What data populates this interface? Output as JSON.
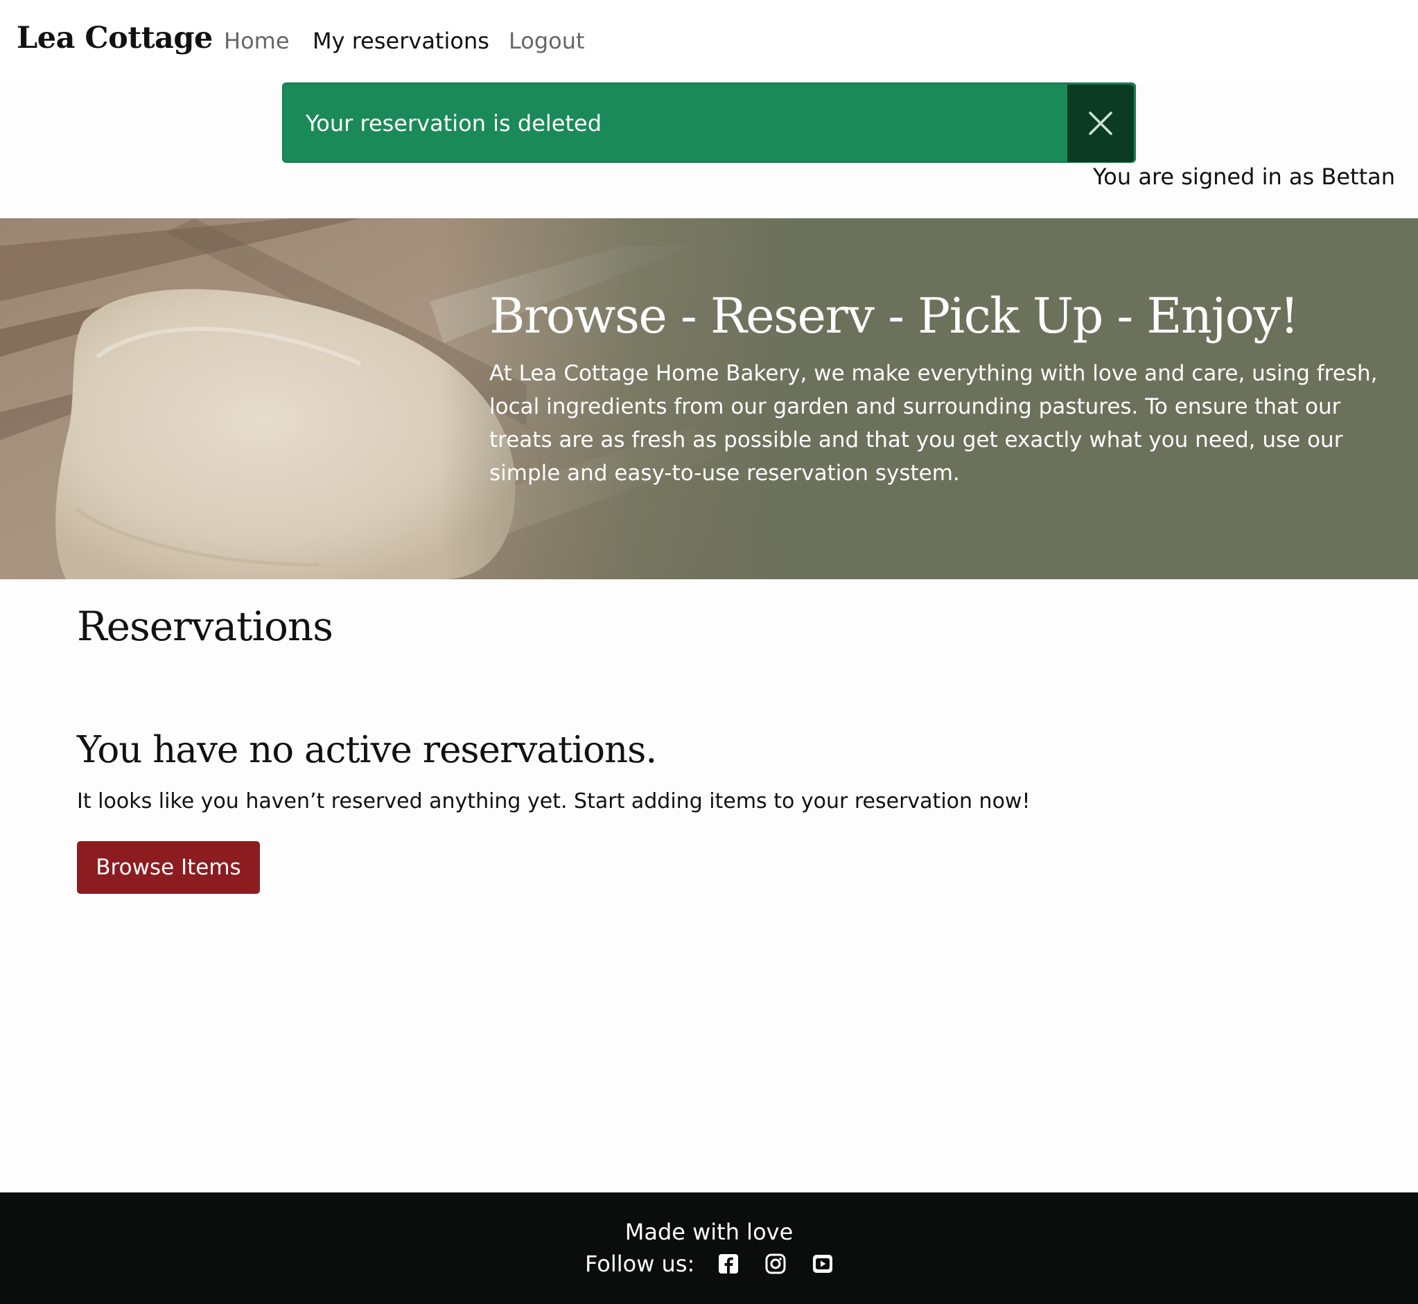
{
  "nav": {
    "brand": "Lea Cottage",
    "links": [
      "Home",
      "My reservations",
      "Logout"
    ]
  },
  "alert": {
    "message": "Your reservation is deleted",
    "close_icon": "close-icon"
  },
  "user": {
    "signed_in_text": "You are signed in as Bettan"
  },
  "hero": {
    "title": "Browse - Reserv - Pick Up - Enjoy!",
    "text": "At Lea Cottage Home Bakery, we make everything with love and care, using fresh, local ingredients from our garden and surrounding pastures. To ensure that our treats are as fresh as possible and that you get exactly what you need, use our simple and easy-to-use reservation system.",
    "image": "bread-dough-image"
  },
  "main": {
    "heading": "Reservations",
    "empty_title": "You have no active reservations.",
    "empty_text": "It looks like you haven’t reserved anything yet. Start adding items to your reservation now!",
    "browse_button": "Browse Items"
  },
  "footer": {
    "made_with": "Made with love",
    "follow": "Follow us:",
    "social_icons": [
      "facebook-icon",
      "instagram-icon",
      "youtube-icon"
    ]
  },
  "colors": {
    "alert_green": "#1b8a59",
    "alert_close": "#0c3b24",
    "hero_olive": "#6c715b",
    "button_red": "#8c1c1f",
    "footer_black": "#0b0d0c"
  }
}
